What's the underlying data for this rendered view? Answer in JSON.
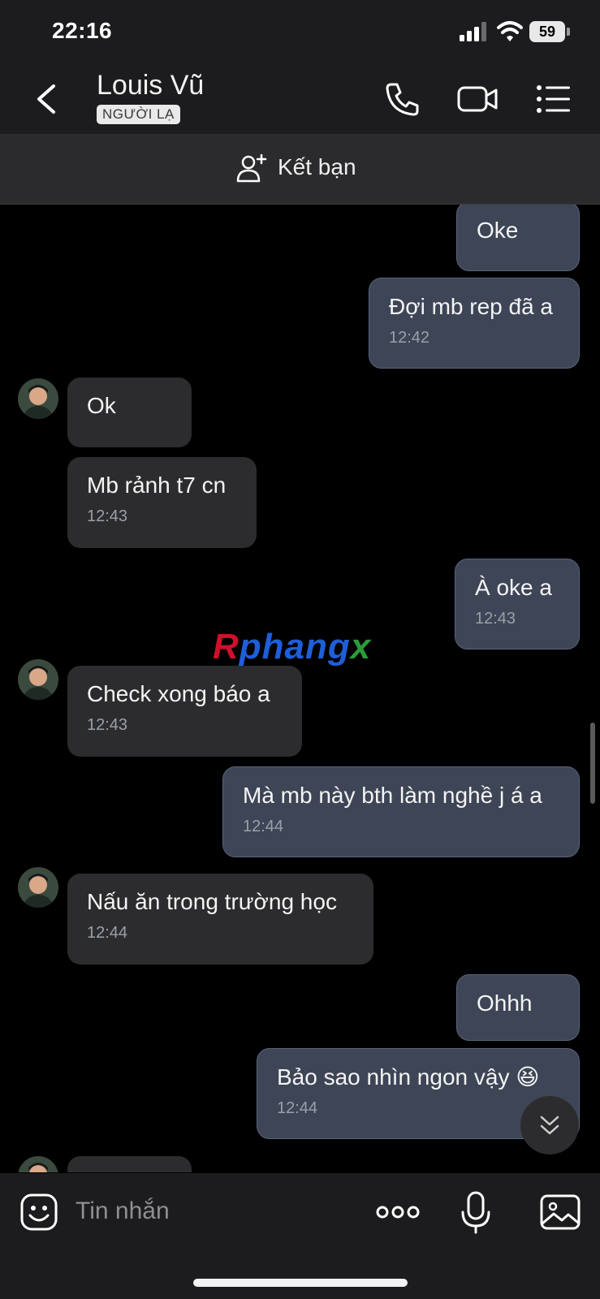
{
  "status_bar": {
    "time": "22:16",
    "battery": "59"
  },
  "header": {
    "contact_name": "Louis Vũ",
    "badge": "NGƯỜI LẠ"
  },
  "friend_bar": {
    "label": "Kết bạn"
  },
  "watermark": {
    "part1": "R",
    "part2": "phang",
    "part3": "x"
  },
  "messages": [
    {
      "direction": "out",
      "text": "Oke",
      "time": ""
    },
    {
      "direction": "out",
      "text": "Đợi mb rep đã a",
      "time": "12:42"
    },
    {
      "direction": "in",
      "text": "Ok",
      "time": ""
    },
    {
      "direction": "in",
      "text": "Mb rảnh t7 cn",
      "time": "12:43"
    },
    {
      "direction": "out",
      "text": "À oke  a",
      "time": "12:43"
    },
    {
      "direction": "in",
      "text": "Check xong báo a",
      "time": "12:43"
    },
    {
      "direction": "out",
      "text": "Mà mb này bth làm nghề j á a",
      "time": "12:44"
    },
    {
      "direction": "in",
      "text": "Nấu ăn trong trường học",
      "time": "12:44"
    },
    {
      "direction": "out",
      "text": "Ohhh",
      "time": ""
    },
    {
      "direction": "out",
      "text": "Bảo sao nhìn ngon vậy 😆",
      "time": "12:44"
    }
  ],
  "composer": {
    "placeholder": "Tin nhắn"
  },
  "icons": [
    "back-icon",
    "phone-icon",
    "video-call-icon",
    "menu-list-icon",
    "add-friend-icon",
    "emoji-sticker-icon",
    "more-dots-icon",
    "microphone-icon",
    "image-icon",
    "chevron-double-down-icon"
  ]
}
